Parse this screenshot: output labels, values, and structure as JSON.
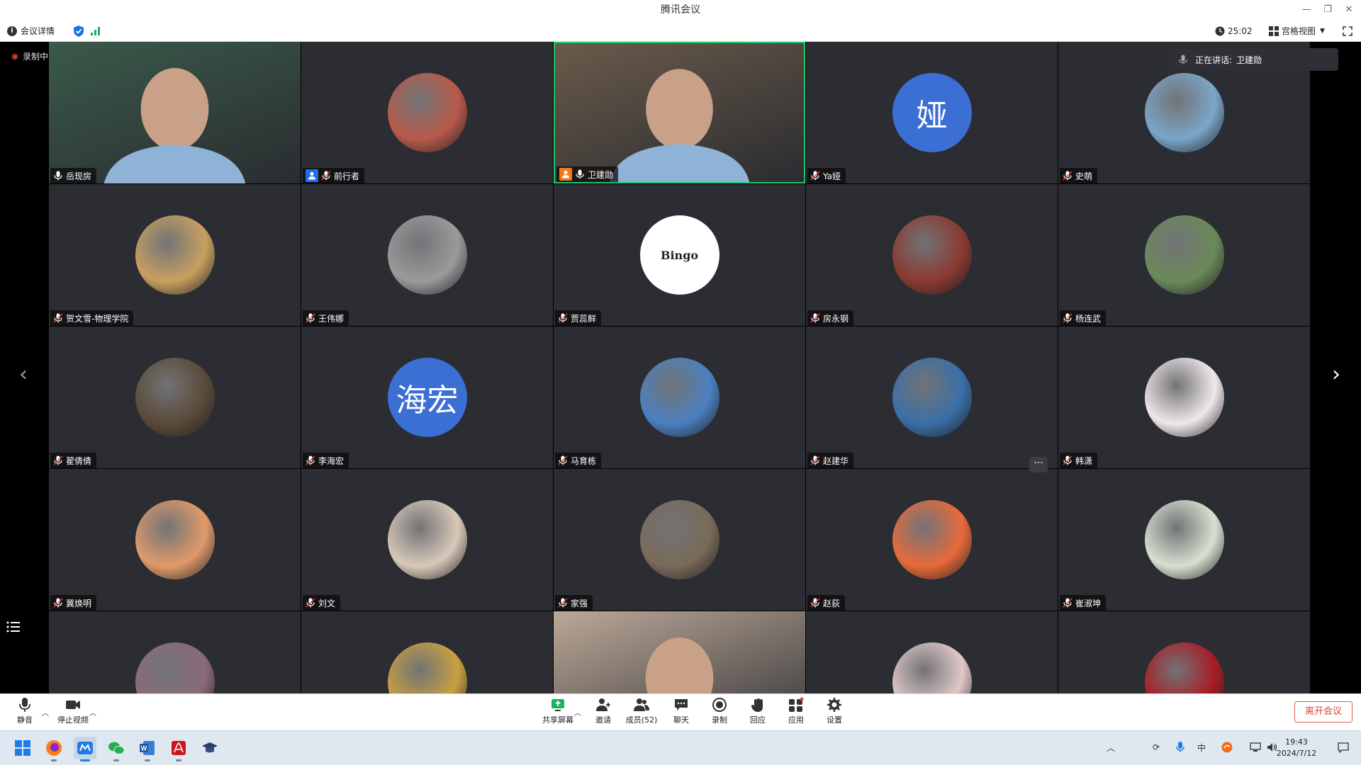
{
  "window": {
    "title": "腾讯会议",
    "controls": [
      "—",
      "❐",
      "✕"
    ]
  },
  "infobar": {
    "meeting_info_label": "会议详情",
    "timer": "25:02",
    "view_mode": "宫格视图"
  },
  "recording_label": "录制中",
  "speaking": {
    "label": "正在讲话:",
    "name": "卫建勋"
  },
  "participants": [
    {
      "name": "岳现房",
      "avatar": "video",
      "color": "#3a5a4a"
    },
    {
      "name": "前行者",
      "avatar": "image",
      "color": "#b85a4a",
      "role": "host"
    },
    {
      "name": "卫建勋",
      "avatar": "video",
      "color": "#6a5a4a",
      "role": "cohost",
      "active": true
    },
    {
      "name": "Ya娅",
      "avatar": "text",
      "initials": "娅",
      "color": "#3b6fd4"
    },
    {
      "name": "史萌",
      "avatar": "image",
      "color": "#7aa6c8"
    },
    {
      "name": "贺文雪-物理学院",
      "avatar": "image",
      "color": "#c8a060"
    },
    {
      "name": "王伟娜",
      "avatar": "image",
      "color": "#9a9a9a"
    },
    {
      "name": "贾蕊鲜",
      "avatar": "image",
      "color": "#ffffff",
      "glyph": "Bingo"
    },
    {
      "name": "房永钢",
      "avatar": "image",
      "color": "#8a3a30"
    },
    {
      "name": "杨连武",
      "avatar": "image",
      "color": "#6a8a5a"
    },
    {
      "name": "翟倩倩",
      "avatar": "image",
      "color": "#5a4a3a"
    },
    {
      "name": "李海宏",
      "avatar": "text",
      "initials": "海宏",
      "color": "#3b6fd4"
    },
    {
      "name": "马育栋",
      "avatar": "image",
      "color": "#4a80c0"
    },
    {
      "name": "赵建华",
      "avatar": "image",
      "color": "#3a6fa8"
    },
    {
      "name": "韩潇",
      "avatar": "image",
      "color": "#f0e8ea"
    },
    {
      "name": "冀焕明",
      "avatar": "image",
      "color": "#e09a6a"
    },
    {
      "name": "刘文",
      "avatar": "image",
      "color": "#d8c8b8"
    },
    {
      "name": "家强",
      "avatar": "image",
      "color": "#7a6a5a"
    },
    {
      "name": "赵荻",
      "avatar": "image",
      "color": "#e86a3a"
    },
    {
      "name": "崔淑坤",
      "avatar": "image",
      "color": "#d8e0d0"
    },
    {
      "name": "",
      "avatar": "image",
      "color": "#8a6a7a"
    },
    {
      "name": "",
      "avatar": "image",
      "color": "#c8a040"
    },
    {
      "name": "",
      "avatar": "video",
      "color": "#bca898"
    },
    {
      "name": "",
      "avatar": "image",
      "color": "#e0c8c8"
    },
    {
      "name": "",
      "avatar": "image",
      "color": "#a81c24"
    }
  ],
  "toolbar": {
    "mute": "静音",
    "stop_video": "停止视频",
    "share_screen": "共享屏幕",
    "invite": "邀请",
    "members": "成员(52)",
    "chat": "聊天",
    "record": "录制",
    "reactions": "回应",
    "apps": "应用",
    "settings": "设置",
    "leave": "离开会议"
  },
  "taskbar": {
    "time": "19:43",
    "date": "2024/7/12",
    "ime": "中"
  },
  "colors": {
    "accent_green": "#1fc86c",
    "tile_bg": "#2b2d32",
    "avatar_blue": "#3b6fd4",
    "leave_red": "#e24437"
  }
}
